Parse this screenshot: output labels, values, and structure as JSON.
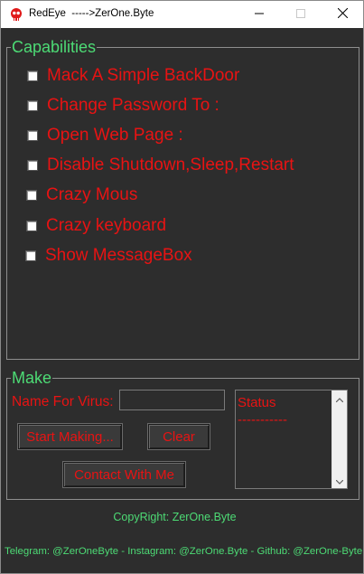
{
  "window": {
    "title": "RedEye  ----->ZerOne.Byte",
    "icon": "redeye-skull-icon"
  },
  "capabilities": {
    "legend": "Capabilities",
    "items": [
      {
        "label": "Mack A Simple BackDoor",
        "checked": false
      },
      {
        "label": "Change Password To :",
        "checked": false
      },
      {
        "label": "Open Web Page :",
        "checked": false
      },
      {
        "label": "Disable Shutdown,Sleep,Restart",
        "checked": false
      },
      {
        "label": "Crazy Mous",
        "checked": false
      },
      {
        "label": "Crazy keyboard",
        "checked": false
      },
      {
        "label": "Show MessageBox",
        "checked": false
      }
    ]
  },
  "make": {
    "legend": "Make",
    "virus_name_label": "Name For Virus:",
    "virus_name_value": "",
    "start_button": "Start Making...",
    "clear_button": "Clear",
    "contact_button": "Contact With Me",
    "status_text": "Status\n-----------"
  },
  "copyright": "CopyRight: ZerOne.Byte",
  "footer": "Telegram: @ZerOneByte - Instagram: @ZerOne.Byte - Github: @ZerOne-Byte",
  "colors": {
    "background": "#2d2d2d",
    "accent_green": "#4ddb75",
    "text_red": "#e81313"
  }
}
